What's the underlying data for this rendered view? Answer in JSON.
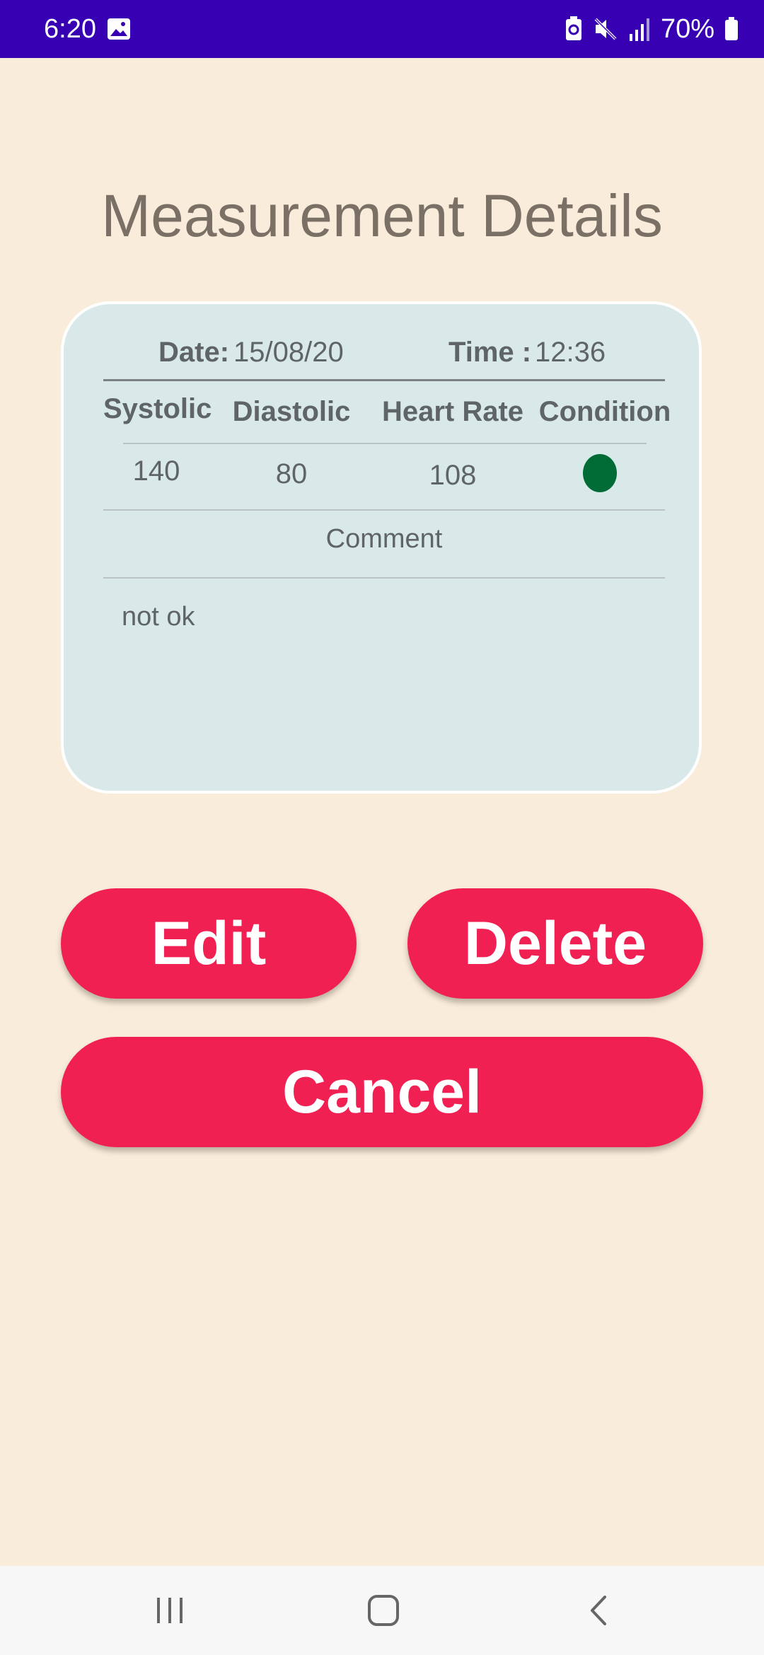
{
  "status_bar": {
    "time": "6:20",
    "battery": "70%",
    "background_color": "#3700b3",
    "icons": [
      "gallery-icon",
      "data-saver-icon",
      "mute-icon",
      "signal-icon",
      "battery-icon"
    ]
  },
  "page": {
    "title": "Measurement Details",
    "background_color": "#faecda"
  },
  "card": {
    "date_label": "Date:",
    "date_value": "15/08/20",
    "time_label": "Time :",
    "time_value": "12:36",
    "columns": [
      "Systolic",
      "Diastolic",
      "Heart Rate",
      "Condition"
    ],
    "row": {
      "systolic": "140",
      "diastolic": "80",
      "heart_rate": "108",
      "condition_color": "#006b35"
    },
    "comment_header": "Comment",
    "comment_text": "not ok"
  },
  "buttons": {
    "edit": "Edit",
    "delete": "Delete",
    "cancel": "Cancel",
    "color": "#f02052"
  },
  "nav_bar": {
    "icons": [
      "recents-icon",
      "home-icon",
      "back-icon"
    ]
  }
}
